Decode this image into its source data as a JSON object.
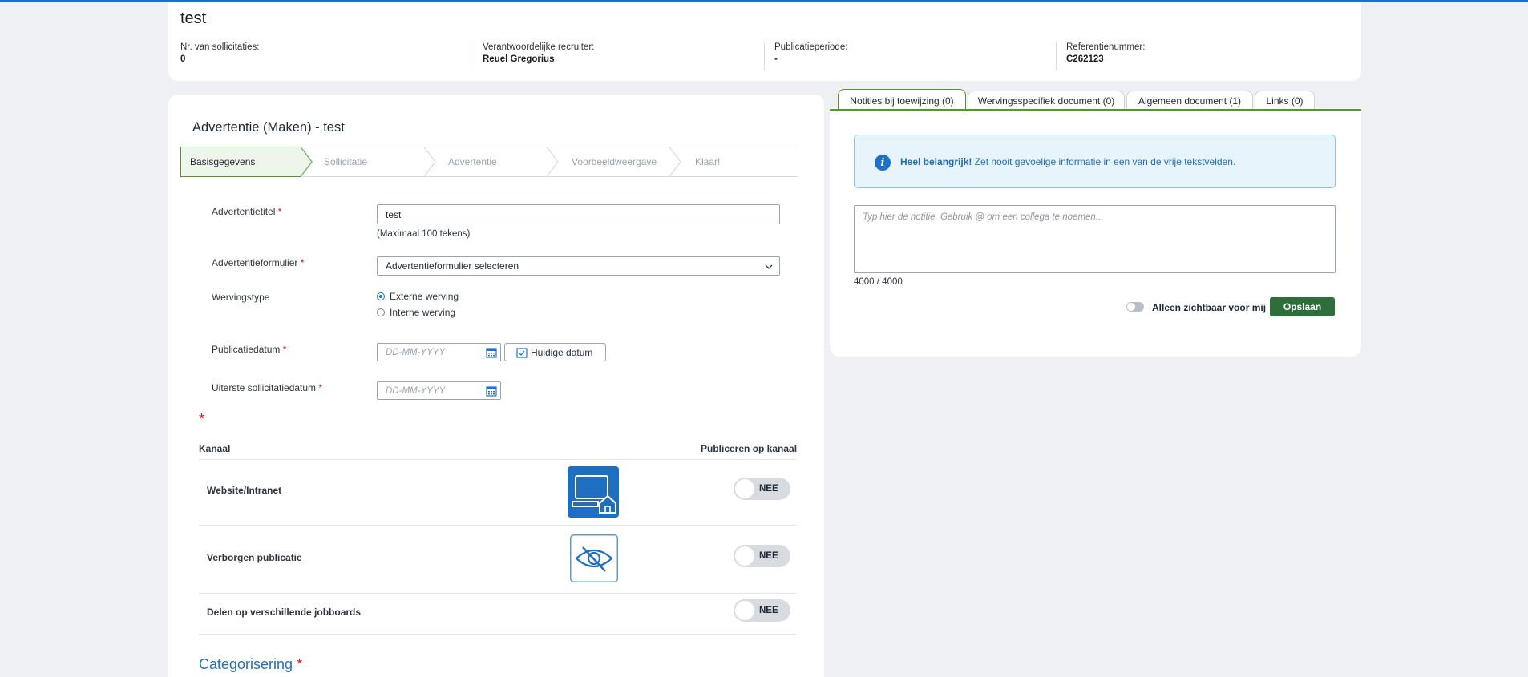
{
  "header": {
    "title": "test",
    "meta": [
      {
        "key": "Nr. van sollicitaties:",
        "value": "0"
      },
      {
        "key": "Verantwoordelijke recruiter:",
        "value": "Reuel Gregorius"
      },
      {
        "key": "Publicatieperiode:",
        "value": "-"
      },
      {
        "key": "Referentienummer:",
        "value": "C262123"
      }
    ]
  },
  "form": {
    "page_title": "Advertentie (Maken) - test",
    "steps": [
      "Basisgegevens",
      "Sollicitatie",
      "Advertentie",
      "Voorbeeldweergave",
      "Klaar!"
    ],
    "active_step": 0,
    "title_label": "Advertentietitel",
    "title_value": "test",
    "title_hint": "(Maximaal 100 tekens)",
    "form_label": "Advertentieformulier",
    "form_value": "Advertentieformulier selecteren",
    "recruit_label": "Wervingstype",
    "recruit_options": [
      "Externe werving",
      "Interne werving"
    ],
    "recruit_selected": 0,
    "pub_date_label": "Publicatiedatum",
    "date_placeholder": "DD-MM-YYYY",
    "today_button": "Huidige datum",
    "deadline_label": "Uiterste sollicitatiedatum",
    "required_mark": "*",
    "channel_header": "Kanaal",
    "publish_header": "Publiceren op kanaal",
    "channels": [
      {
        "name": "Website/Intranet",
        "icon": "website-intranet-icon",
        "state": "NEE"
      },
      {
        "name": "Verborgen publicatie",
        "icon": "hidden-eye-icon",
        "state": "NEE"
      },
      {
        "name": "Delen op verschillende jobboards",
        "icon": "",
        "state": "NEE"
      }
    ],
    "categorisation_title": "Categorisering"
  },
  "notes": {
    "tabs": [
      "Notities bij toewijzing (0)",
      "Wervingsspecifiek document (0)",
      "Algemeen document (1)",
      "Links (0)"
    ],
    "active_tab": 0,
    "info_bold": "Heel belangrijk!",
    "info_text": " Zet nooit gevoelige informatie in een van de vrije tekstvelden.",
    "placeholder": "Typ hier de notitie. Gebruik @ om een collega te noemen...",
    "counter": "4000 / 4000",
    "private_label": "Alleen zichtbaar voor mij",
    "save_label": "Opslaan"
  },
  "colors": {
    "accent_blue": "#1f6fc4",
    "save_green": "#2d6e3b",
    "tab_green": "#4e9a2a",
    "required_red": "#d01919"
  }
}
